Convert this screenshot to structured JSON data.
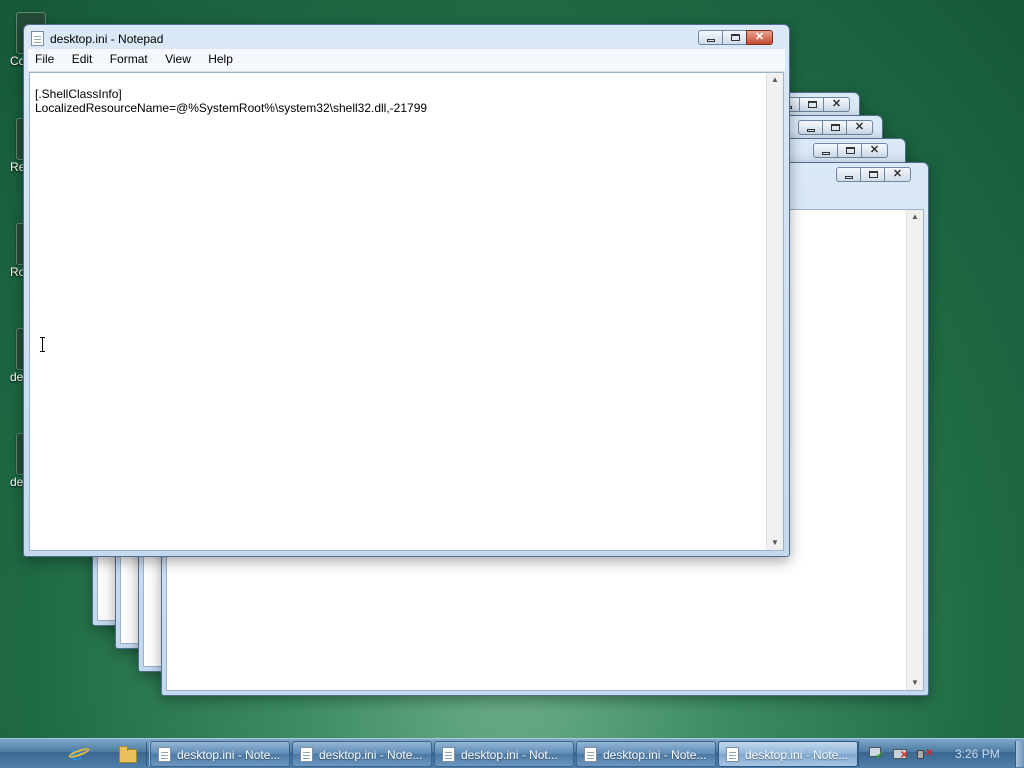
{
  "desktop": {
    "icons": [
      {
        "label": "Co",
        "icon": "computer-icon"
      },
      {
        "label": "Re",
        "icon": "recycle-bin-icon"
      },
      {
        "label": "Ro",
        "icon": "folder-icon"
      },
      {
        "label": "de",
        "icon": "ini-file-icon"
      },
      {
        "label": "de",
        "icon": "ini-file-icon"
      }
    ]
  },
  "notepad": {
    "title": "desktop.ini - Notepad",
    "menu": [
      "File",
      "Edit",
      "Format",
      "View",
      "Help"
    ],
    "content_lines": [
      "[.ShellClassInfo]",
      "LocalizedResourceName=@%SystemRoot%\\system32\\shell32.dll,-21799"
    ]
  },
  "taskbar": {
    "quick_launch": [
      "internet-explorer-icon",
      "folder-icon"
    ],
    "buttons": [
      {
        "label": "desktop.ini - Note...",
        "active": false
      },
      {
        "label": "desktop.ini - Note...",
        "active": false
      },
      {
        "label": "desktop.ini - Not...",
        "active": false
      },
      {
        "label": "desktop.ini - Note...",
        "active": false
      },
      {
        "label": "desktop.ini - Note...",
        "active": true
      }
    ],
    "tray_icons": [
      "network-icon",
      "power-icon",
      "volume-muted-icon"
    ],
    "clock": "3:26 PM"
  }
}
